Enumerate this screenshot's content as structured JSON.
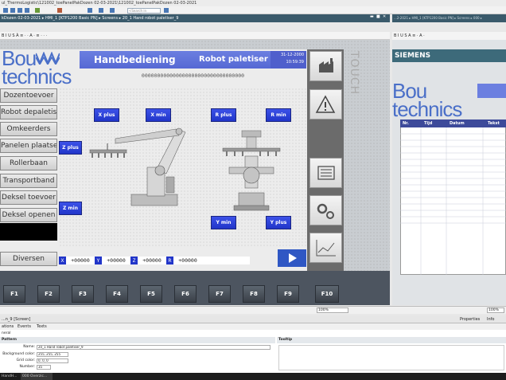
{
  "window": {
    "title": "ul_ThermoLogistic\\121002_toePanelPakDozen 02-03-2021\\121002_toePanelPakDozen 02-03-2021",
    "search_placeholder": "<Search in project>",
    "breadcrumb": "kDozen 02-03-2021 ▸ HMI_1 [KTP1200 Basic PN] ▸ Screens ▸ 20_1 Hand robot paletiser_9",
    "breadcrumb_right": "...2-2021 ▸ HMI_1 [KTP1200 Basic PN] ▸ Screens ▸ 000 ▸",
    "format_bar": "B  I  U  S  Ȧ  ≡  ·  ·  A  ·  ≡  ·  ·  ·",
    "format_bar_right": "B  I  U  S  A  ≡  ·  A  ·"
  },
  "hmi": {
    "logo_line1": "Bou",
    "logo_line2": "technics",
    "header_title": "Handbediening",
    "header_sub": "Robot paletiser",
    "date": "31-12-2000",
    "time": "10:59:39",
    "zeros": "000000000000000000000000000000000",
    "touch_label": "TOUCH",
    "nav_items": [
      {
        "label": "Dozentoevoer"
      },
      {
        "label": "Robot depaletiser"
      },
      {
        "label": "Omkeerders"
      },
      {
        "label": "Panelen plaatsen"
      },
      {
        "label": "Rollerbaan"
      },
      {
        "label": "Transportband"
      },
      {
        "label": "Deksel toevoer"
      },
      {
        "label": "Deksel openen"
      },
      {
        "label": "Diversen"
      }
    ],
    "buttons": {
      "x_plus": "X plus",
      "x_min": "X min",
      "r_plus": "R plus",
      "r_min": "R min",
      "z_plus": "Z plus",
      "z_min": "Z min",
      "y_min": "Y min",
      "y_plus": "Y plus"
    },
    "coords": [
      {
        "label": "X",
        "value": "+00000"
      },
      {
        "label": "Y",
        "value": "+00000"
      },
      {
        "label": "Z",
        "value": "+00000"
      },
      {
        "label": "R",
        "value": "+00000"
      }
    ],
    "fkeys": [
      "F1",
      "F2",
      "F3",
      "F4",
      "F5",
      "F6",
      "F7",
      "F8",
      "F9",
      "F10"
    ]
  },
  "right_panel": {
    "brand": "SIEMENS",
    "logo_line1": "Bou",
    "logo_line2": "technics",
    "table_headers": [
      "Nr.",
      "Tijd",
      "Datum",
      "Tekst"
    ]
  },
  "statusbar": {
    "zoom_left": "100%",
    "zoom_right": "100%"
  },
  "properties": {
    "object_title": "...n_9 [Screen]",
    "tabs": [
      "Properties",
      "Info"
    ],
    "subtabs": [
      "ations",
      "Events",
      "Texts"
    ],
    "section_general": "neral",
    "section_pattern": "Pattern",
    "section_tooltip": "Tooltip",
    "name_label": "Name:",
    "name_value": "20_1 Hand robot paletiser_9",
    "bg_label": "Background color:",
    "bg_value": "255, 255, 255",
    "grid_label": "Grid color:",
    "grid_value": "0, 0, 0",
    "number_label": "Number:",
    "number_value": "35"
  },
  "taskbar": {
    "items": [
      "HandH...",
      "000 Overzic..."
    ]
  },
  "colors": {
    "accent_blue": "#2135c9",
    "header_blue": "#5668d4",
    "logo_blue": "#4a6fc8",
    "siemens_teal": "#3d6a7a"
  }
}
